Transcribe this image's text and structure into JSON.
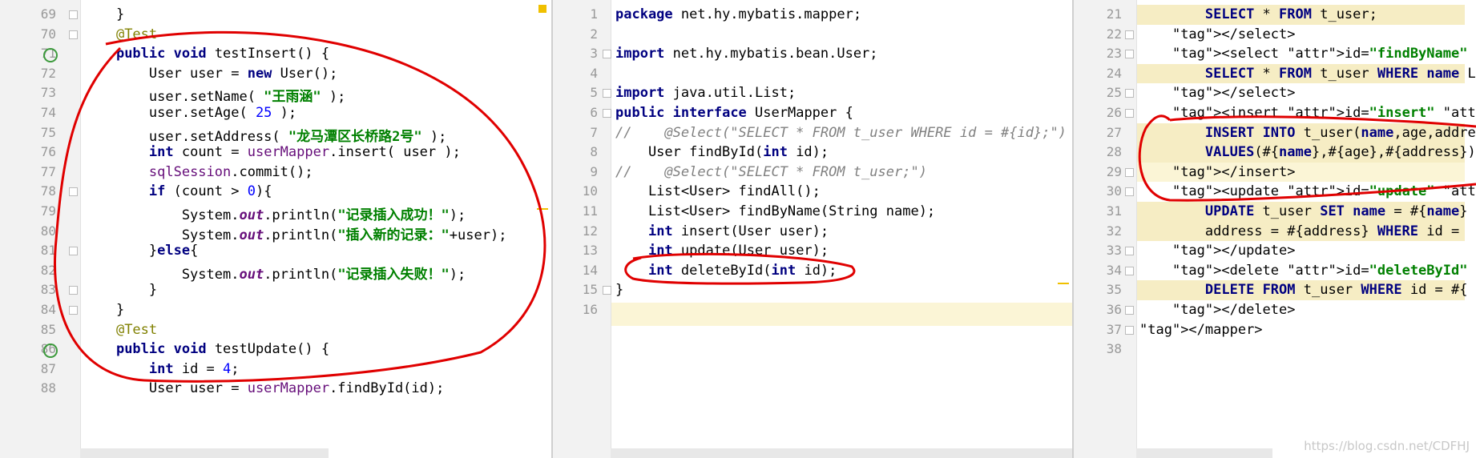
{
  "panes": [
    {
      "id": "test-class",
      "lines": [
        {
          "n": "69",
          "t": "    }"
        },
        {
          "n": "70",
          "t": "    @Test"
        },
        {
          "n": "71",
          "t": "    public void testInsert() {"
        },
        {
          "n": "72",
          "t": "        User user = new User();"
        },
        {
          "n": "73",
          "t": "        user.setName( \"王雨涵\" );"
        },
        {
          "n": "74",
          "t": "        user.setAge( 25 );"
        },
        {
          "n": "75",
          "t": "        user.setAddress( \"龙马潭区长桥路2号\" );"
        },
        {
          "n": "76",
          "t": "        int count = userMapper.insert( user );"
        },
        {
          "n": "77",
          "t": "        sqlSession.commit();"
        },
        {
          "n": "78",
          "t": "        if (count > 0){"
        },
        {
          "n": "79",
          "t": "            System.out.println(\"记录插入成功！\");"
        },
        {
          "n": "80",
          "t": "            System.out.println(\"插入新的记录：\"+user);"
        },
        {
          "n": "81",
          "t": "        }else{"
        },
        {
          "n": "82",
          "t": "            System.out.println(\"记录插入失败！\");"
        },
        {
          "n": "83",
          "t": "        }"
        },
        {
          "n": "84",
          "t": "    }"
        },
        {
          "n": "85",
          "t": "    @Test"
        },
        {
          "n": "86",
          "t": "    public void testUpdate() {"
        },
        {
          "n": "87",
          "t": "        int id = 4;"
        },
        {
          "n": "88",
          "t": "        User user = userMapper.findById(id);"
        }
      ]
    },
    {
      "id": "mapper-interface",
      "lines": [
        {
          "n": "1",
          "t": "package net.hy.mybatis.mapper;"
        },
        {
          "n": "2",
          "t": ""
        },
        {
          "n": "3",
          "t": "import net.hy.mybatis.bean.User;"
        },
        {
          "n": "4",
          "t": ""
        },
        {
          "n": "5",
          "t": "import java.util.List;"
        },
        {
          "n": "6",
          "t": "public interface UserMapper {"
        },
        {
          "n": "7",
          "t": "//    @Select(\"SELECT * FROM t_user WHERE id = #{id};\")"
        },
        {
          "n": "8",
          "t": "    User findById(int id);"
        },
        {
          "n": "9",
          "t": "//    @Select(\"SELECT * FROM t_user;\")"
        },
        {
          "n": "10",
          "t": "    List<User> findAll();"
        },
        {
          "n": "11",
          "t": "    List<User> findByName(String name);"
        },
        {
          "n": "12",
          "t": "    int insert(User user);"
        },
        {
          "n": "13",
          "t": "    int update(User user);"
        },
        {
          "n": "14",
          "t": "    int deleteById(int id);"
        },
        {
          "n": "15",
          "t": "}"
        },
        {
          "n": "16",
          "t": ""
        }
      ]
    },
    {
      "id": "mapper-xml",
      "lines": [
        {
          "n": "21",
          "t": "        SELECT * FROM t_user;"
        },
        {
          "n": "22",
          "t": "    </select>"
        },
        {
          "n": "23",
          "t": "    <select id=\"findByName\" resultType=\"U"
        },
        {
          "n": "24",
          "t": "        SELECT * FROM t_user WHERE name L"
        },
        {
          "n": "25",
          "t": "    </select>"
        },
        {
          "n": "26",
          "t": "    <insert id=\"insert\" parameterType=\"Us"
        },
        {
          "n": "27",
          "t": "        INSERT INTO t_user(name,age,addre"
        },
        {
          "n": "28",
          "t": "        VALUES(#{name},#{age},#{address})"
        },
        {
          "n": "29",
          "t": "    </insert>"
        },
        {
          "n": "30",
          "t": "    <update id=\"update\" parameterType=\"U"
        },
        {
          "n": "31",
          "t": "        UPDATE t_user SET name = #{name}"
        },
        {
          "n": "32",
          "t": "        address = #{address} WHERE id = "
        },
        {
          "n": "33",
          "t": "    </update>"
        },
        {
          "n": "34",
          "t": "    <delete id=\"deleteById\" parameterType"
        },
        {
          "n": "35",
          "t": "        DELETE FROM t_user WHERE id = #{"
        },
        {
          "n": "36",
          "t": "    </delete>"
        },
        {
          "n": "37",
          "t": "</mapper>"
        },
        {
          "n": "38",
          "t": ""
        }
      ]
    }
  ],
  "watermark": "https://blog.csdn.net/CDFHJ",
  "colors": {
    "keyword": "#000080",
    "string": "#008000",
    "annotation": "#808000",
    "comment": "#808080",
    "number": "#0000ff",
    "ink": "#e00000"
  }
}
